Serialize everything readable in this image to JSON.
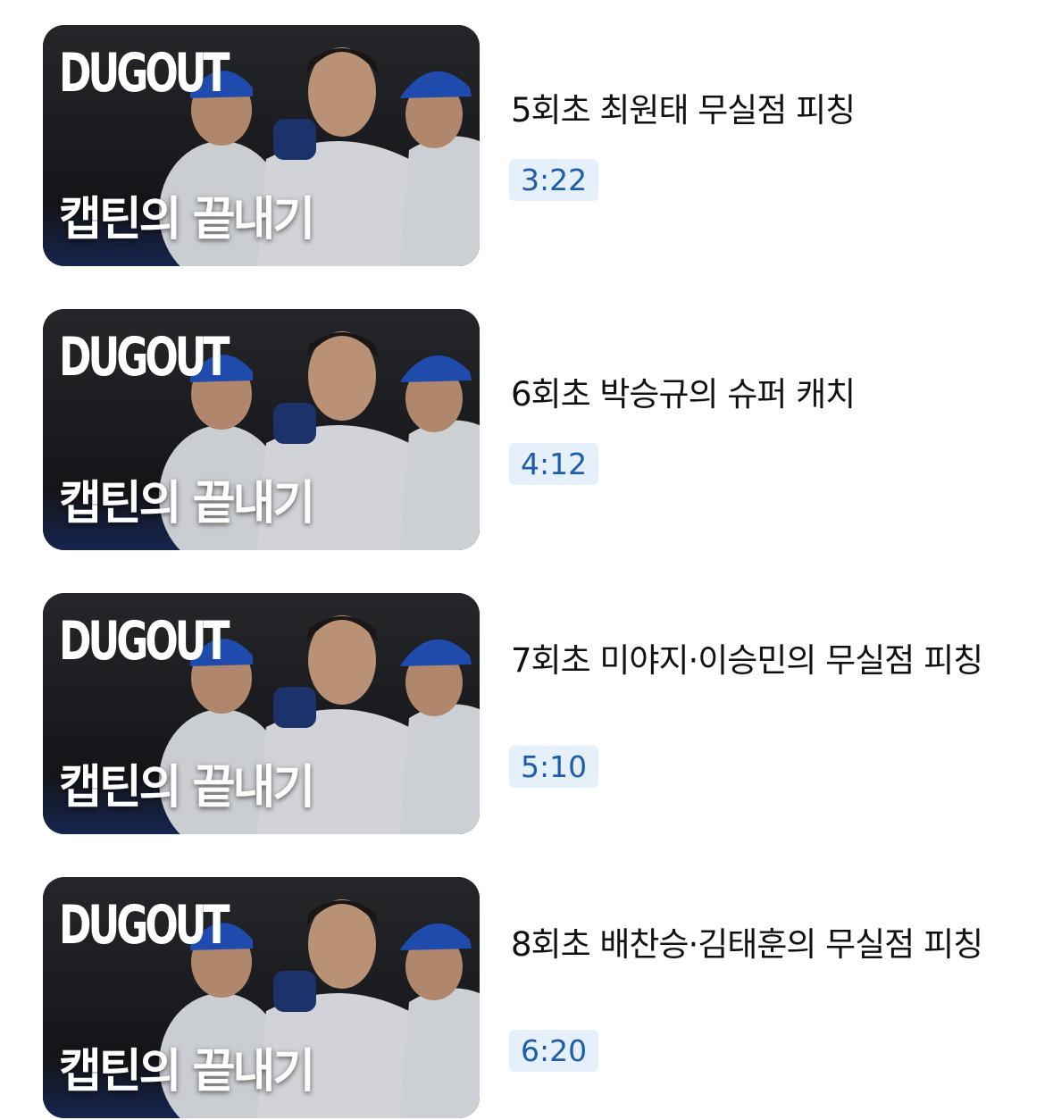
{
  "videos": [
    {
      "thumbnail": {
        "logo": "DUGOUT",
        "caption": "캡틴의 끝내기"
      },
      "title": "5회초 최원태 무실점 피칭",
      "duration": "3:22"
    },
    {
      "thumbnail": {
        "logo": "DUGOUT",
        "caption": "캡틴의 끝내기"
      },
      "title": "6회초 박승규의 슈퍼 캐치",
      "duration": "4:12"
    },
    {
      "thumbnail": {
        "logo": "DUGOUT",
        "caption": "캡틴의 끝내기"
      },
      "title": "7회초 미야지·이승민의 무실점 피칭",
      "duration": "5:10"
    },
    {
      "thumbnail": {
        "logo": "DUGOUT",
        "caption": "캡틴의 끝내기"
      },
      "title": "8회초 배찬승·김태훈의 무실점 피칭",
      "duration": "6:20"
    }
  ],
  "colors": {
    "duration_bg": "#e5f0fb",
    "duration_text": "#1d5dab",
    "cap_blue": "#2456c5",
    "jersey": "#e9edf3"
  }
}
